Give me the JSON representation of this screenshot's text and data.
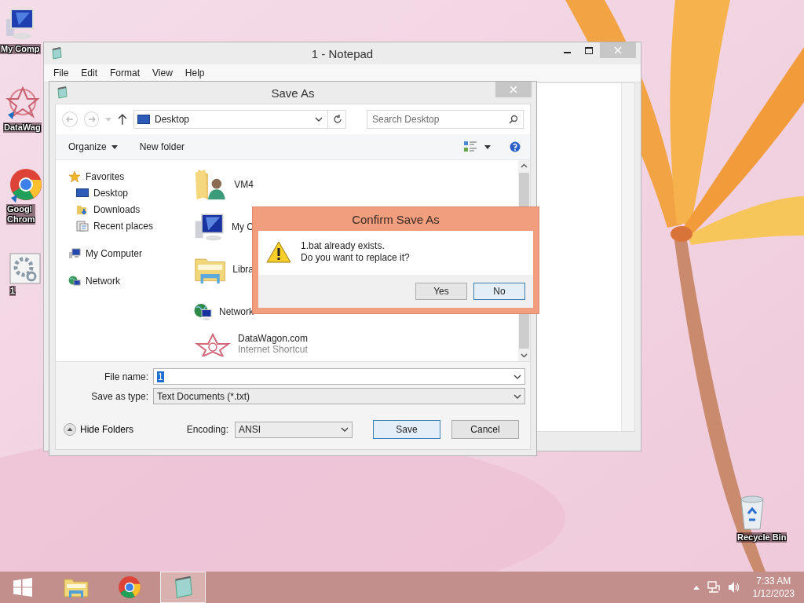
{
  "desktop": {
    "icons": [
      {
        "kind": "computer",
        "label": "My Comp"
      },
      {
        "kind": "web",
        "label": "DataWag"
      },
      {
        "kind": "chrome",
        "label": "Googl\nChrom"
      },
      {
        "kind": "settings",
        "label": "1"
      },
      {
        "kind": "recycle",
        "label": "Recycle Bin"
      }
    ]
  },
  "notepad": {
    "title": "1 - Notepad",
    "menu": [
      "File",
      "Edit",
      "Format",
      "View",
      "Help"
    ]
  },
  "save_as": {
    "title": "Save As",
    "address": "Desktop",
    "search": {
      "placeholder": "Search Desktop"
    },
    "toolbar": {
      "organize": "Organize",
      "new_folder": "New folder"
    },
    "nav_pane": [
      {
        "kind": "favorites",
        "label": "Favorites",
        "children": [
          {
            "kind": "desktop",
            "label": "Desktop"
          },
          {
            "kind": "downloads",
            "label": "Downloads"
          },
          {
            "kind": "recent",
            "label": "Recent places"
          }
        ]
      },
      {
        "kind": "computer",
        "label": "My Computer"
      },
      {
        "kind": "network",
        "label": "Network"
      }
    ],
    "files": [
      {
        "kind": "user",
        "name": "VM4"
      },
      {
        "kind": "computer",
        "name": "My C"
      },
      {
        "kind": "libraries",
        "name": "Libra"
      },
      {
        "kind": "network",
        "name": "Network"
      },
      {
        "kind": "web",
        "name": "DataWagon.com",
        "subtitle": "Internet Shortcut"
      }
    ],
    "file_name": {
      "label": "File name:",
      "value": "1",
      "value_selected": true
    },
    "save_type": {
      "label": "Save as type:",
      "value": "Text Documents (*.txt)"
    },
    "hide_folders": "Hide Folders",
    "encoding": {
      "label": "Encoding:",
      "value": "ANSI"
    },
    "buttons": [
      {
        "label": "Save",
        "focused": true
      },
      {
        "label": "Cancel",
        "focused": false
      }
    ]
  },
  "confirm": {
    "title": "Confirm Save As",
    "message": [
      "1.bat already exists.",
      "Do you want to replace it?"
    ],
    "buttons": [
      {
        "label": "Yes",
        "focused": false
      },
      {
        "label": "No",
        "focused": true
      }
    ]
  },
  "taskbar": {
    "apps": [
      {
        "kind": "explorer",
        "active": false
      },
      {
        "kind": "chrome",
        "active": false
      },
      {
        "kind": "notepad",
        "active": true
      }
    ],
    "time": "7:33 AM",
    "date": "1/12/2023"
  }
}
